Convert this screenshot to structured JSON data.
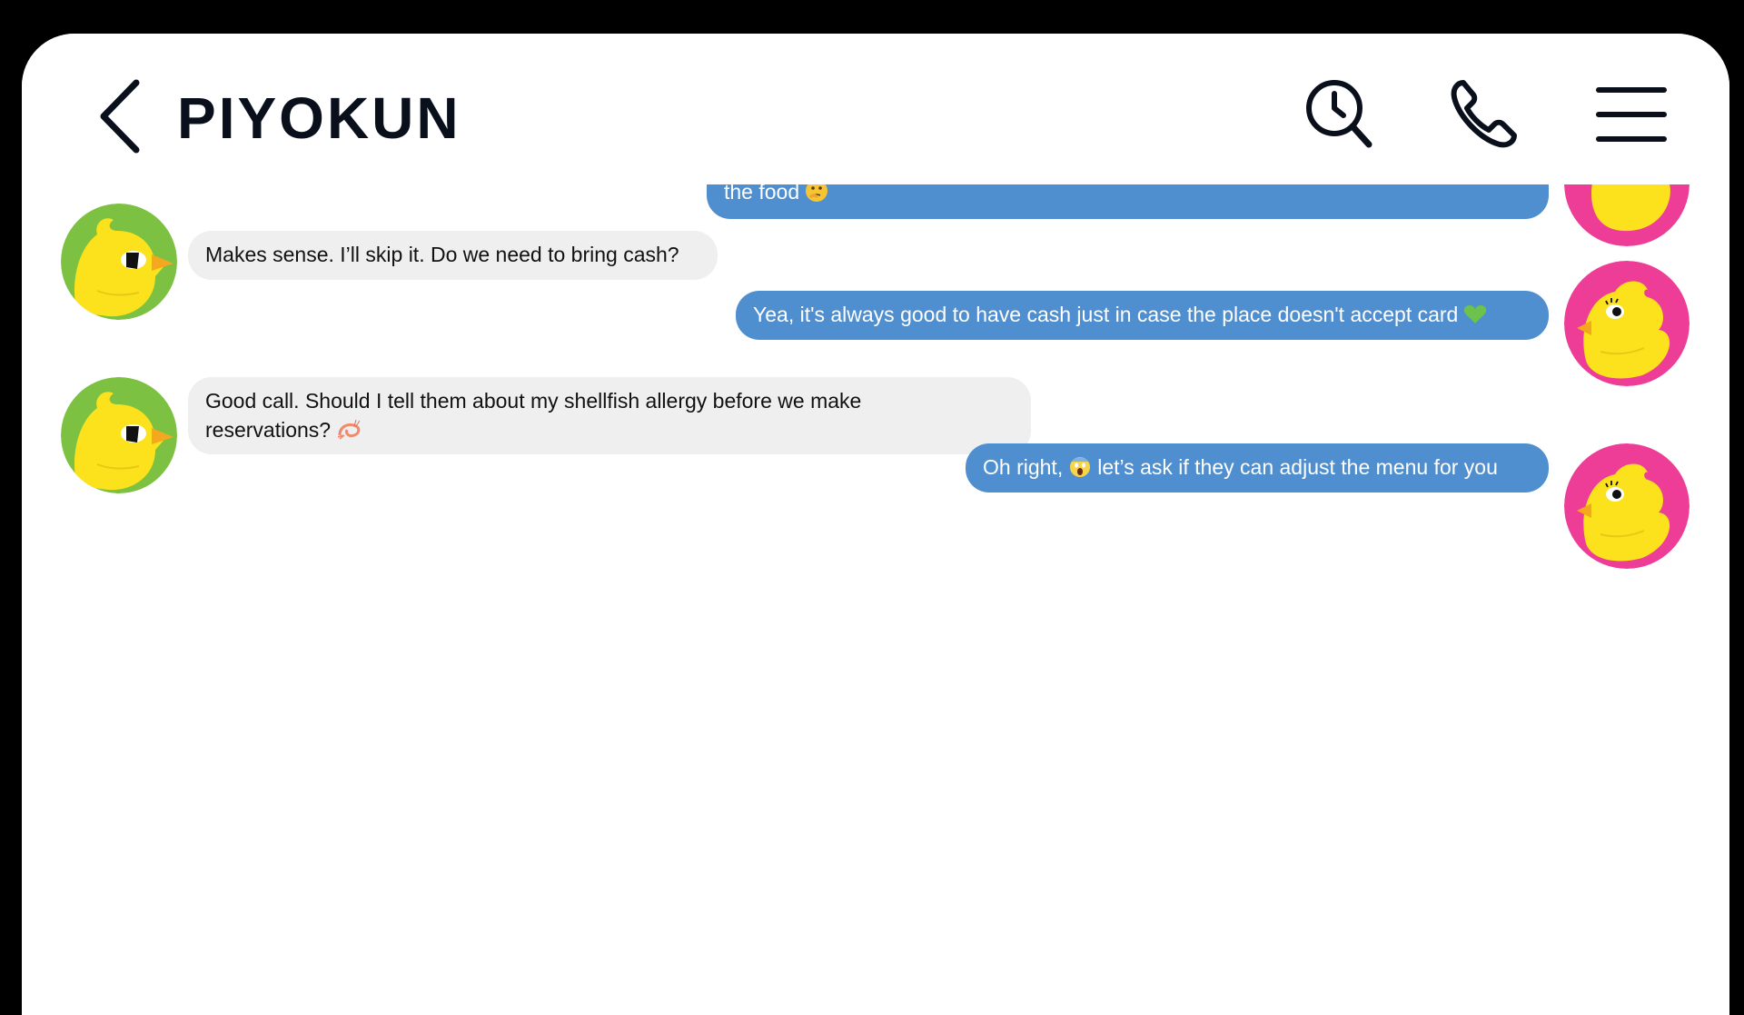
{
  "header": {
    "title": "PIYOKUN",
    "icons": [
      "back-chevron-icon",
      "history-search-icon",
      "phone-icon",
      "menu-icon"
    ]
  },
  "messages": [
    {
      "sender": "me",
      "text": "the food",
      "emoji": "thinking-face-emoji"
    },
    {
      "sender": "friend",
      "text": "Makes sense. I’ll skip it. Do we need to bring cash?"
    },
    {
      "sender": "me",
      "text": "Yea, it's always good to have cash just in case the place doesn't accept card",
      "emoji": "green-heart-emoji"
    },
    {
      "sender": "friend",
      "text_line1": "Good call. Should I tell them about my shellfish allergy before we make",
      "text_line2": "reservations?",
      "emoji": "shrimp-emoji"
    },
    {
      "sender": "me",
      "text_before": "Oh right,",
      "text_after": "let’s ask if they can adjust the menu for you",
      "emoji": "screaming-face-emoji"
    }
  ],
  "colors": {
    "outgoing_bubble": "#4f8fcf",
    "incoming_bubble": "#efefef",
    "friend_avatar_bg": "#7cc142",
    "me_avatar_bg": "#ee3d96",
    "chick_yellow": "#fbe21c",
    "header_text": "#0a0f1c"
  }
}
